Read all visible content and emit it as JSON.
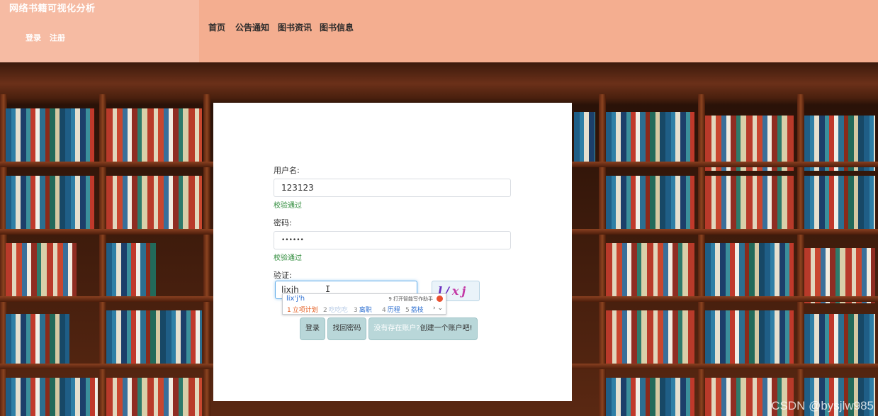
{
  "header": {
    "app_title": "网络书籍可视化分析",
    "auth": {
      "login": "登录",
      "register": "注册"
    },
    "nav": [
      "首页",
      "公告通知",
      "图书资讯",
      "图书信息"
    ]
  },
  "form": {
    "username_label": "用户名:",
    "username_value": "123123",
    "username_status": "校验通过",
    "password_label": "密码:",
    "password_value": "••••••",
    "password_status": "校验通过",
    "captcha_label": "验证:",
    "captcha_value": "lixjh",
    "captcha_image_text": [
      "l/",
      "xj"
    ]
  },
  "ime": {
    "composition": "lix'j'h",
    "hint": "9 打开智能写作助手",
    "candidates": [
      {
        "num": "1",
        "text": "立项计划"
      },
      {
        "num": "2",
        "text": "吃吃吃"
      },
      {
        "num": "3",
        "text": "离职"
      },
      {
        "num": "4",
        "text": "历程"
      },
      {
        "num": "5",
        "text": "荔枝"
      }
    ],
    "nav": "› ⌄"
  },
  "buttons": {
    "login": "登录",
    "forgot": "找回密码",
    "create_prefix": "没有存在账户?",
    "create_suffix": "创建一个账户吧!"
  },
  "watermark": "CSDN @bysjlw985",
  "colors": {
    "header_bg": "#f4ae90",
    "brand_bg": "#f6bba3",
    "valid": "#2e8b3a",
    "button_bg": "#b9d7d9"
  }
}
